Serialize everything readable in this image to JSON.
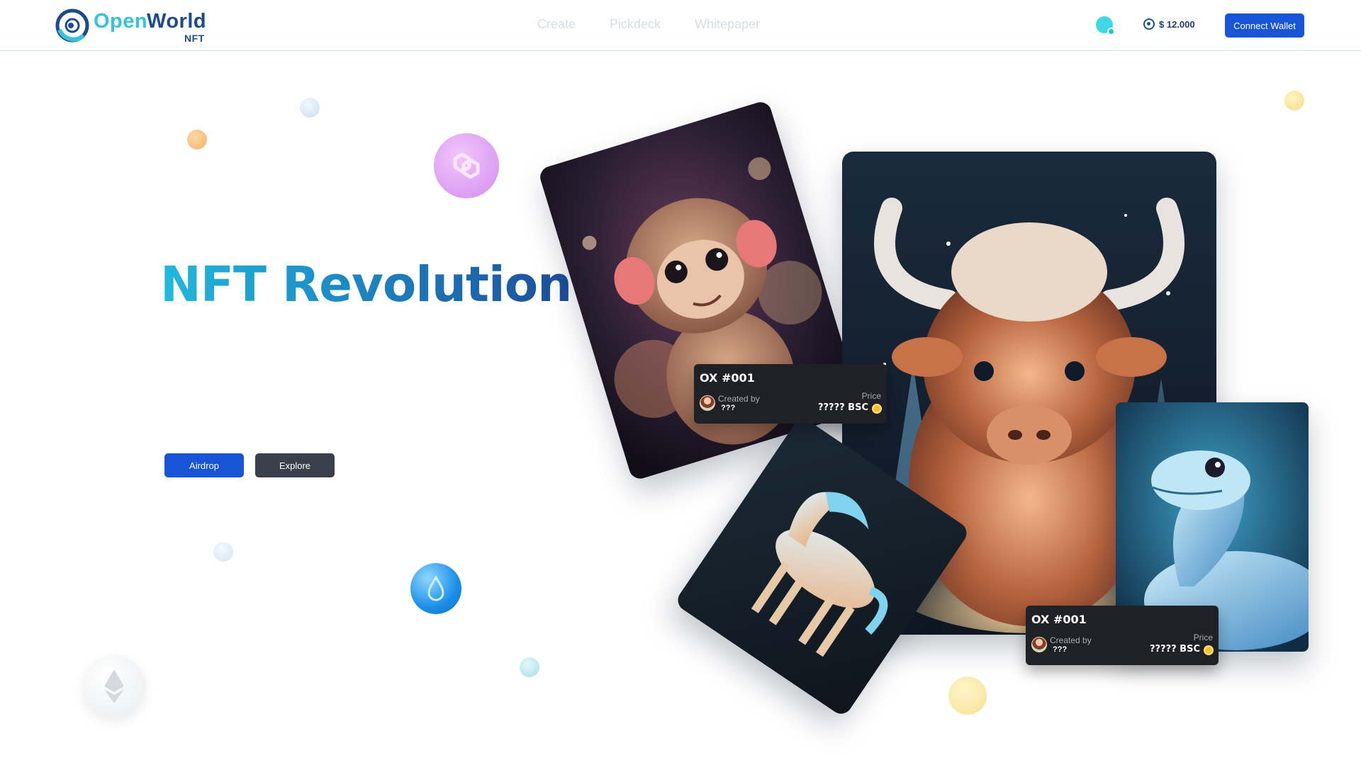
{
  "brand": {
    "open": "Open",
    "world": "World",
    "nft": "NFT"
  },
  "nav": {
    "items": [
      "Create",
      "Pickdeck",
      "Whitepaper"
    ]
  },
  "header": {
    "balance": "$ 12.000",
    "connect_label": "Connect Wallet"
  },
  "hero": {
    "title": "NFT Revolution",
    "airdrop_label": "Airdrop",
    "explore_label": "Explore"
  },
  "cards": [
    {
      "title": "OX #001",
      "created_by_label": "Created by",
      "creator": "???",
      "price_label": "Price",
      "price": "????? BSC"
    },
    {
      "title": "OX #001",
      "created_by_label": "Created by",
      "creator": "???",
      "price_label": "Price",
      "price": "????? BSC"
    }
  ],
  "colors": {
    "accent_blue": "#1855d6",
    "explore_gray": "#3a4049",
    "title_gradient_start": "#22b8dc",
    "title_gradient_end": "#1b4d9a",
    "status_cyan": "#3fd6e6"
  },
  "icons": [
    "logo-icon",
    "wallet-balance-icon",
    "status-indicator",
    "polygon-coin-icon",
    "ethereum-coin-icon",
    "drop-coin-icon",
    "bsc-coin-icon"
  ]
}
